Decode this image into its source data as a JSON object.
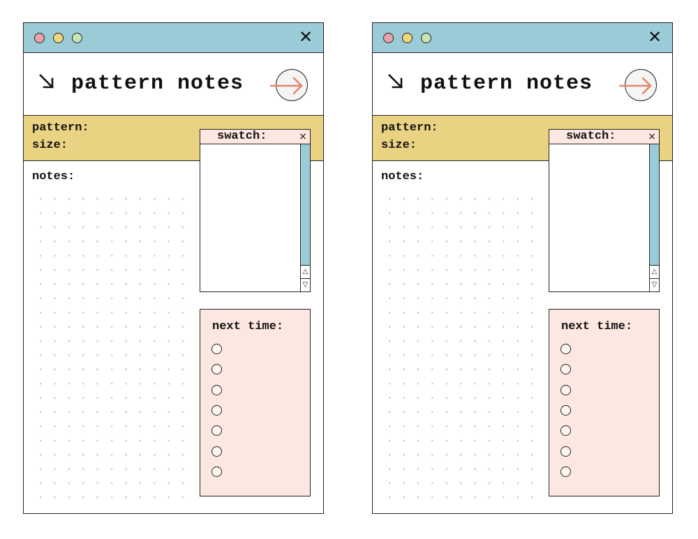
{
  "colors": {
    "titlebar": "#9ccbd8",
    "dot_red": "#e8a2ad",
    "dot_yellow": "#efd87c",
    "dot_green": "#c9e4b3",
    "meta_band": "#e9d383",
    "panel_pink": "#fde8e1",
    "arrow_accent": "#e0876c",
    "grid_dot": "#cfc7b6"
  },
  "icons": {
    "window_close": "close-icon",
    "title_marker": "arrow-down-right-icon",
    "next_button": "arrow-right-icon",
    "swatch_close": "close-icon",
    "scroll_up": "triangle-up-icon",
    "scroll_down": "triangle-down-icon",
    "checkbox": "circle-outline-icon"
  },
  "glyphs": {
    "close": "✕",
    "small_close": "×",
    "scroll_up": "△",
    "scroll_down": "▽"
  },
  "pages": [
    {
      "title": "pattern notes",
      "fields": {
        "pattern_label": "pattern:",
        "size_label": "size:"
      },
      "notes_label": "notes:",
      "swatch_title": "swatch:",
      "next_time_title": "next time:",
      "checklist_count": 7
    },
    {
      "title": "pattern notes",
      "fields": {
        "pattern_label": "pattern:",
        "size_label": "size:"
      },
      "notes_label": "notes:",
      "swatch_title": "swatch:",
      "next_time_title": "next time:",
      "checklist_count": 7
    }
  ]
}
